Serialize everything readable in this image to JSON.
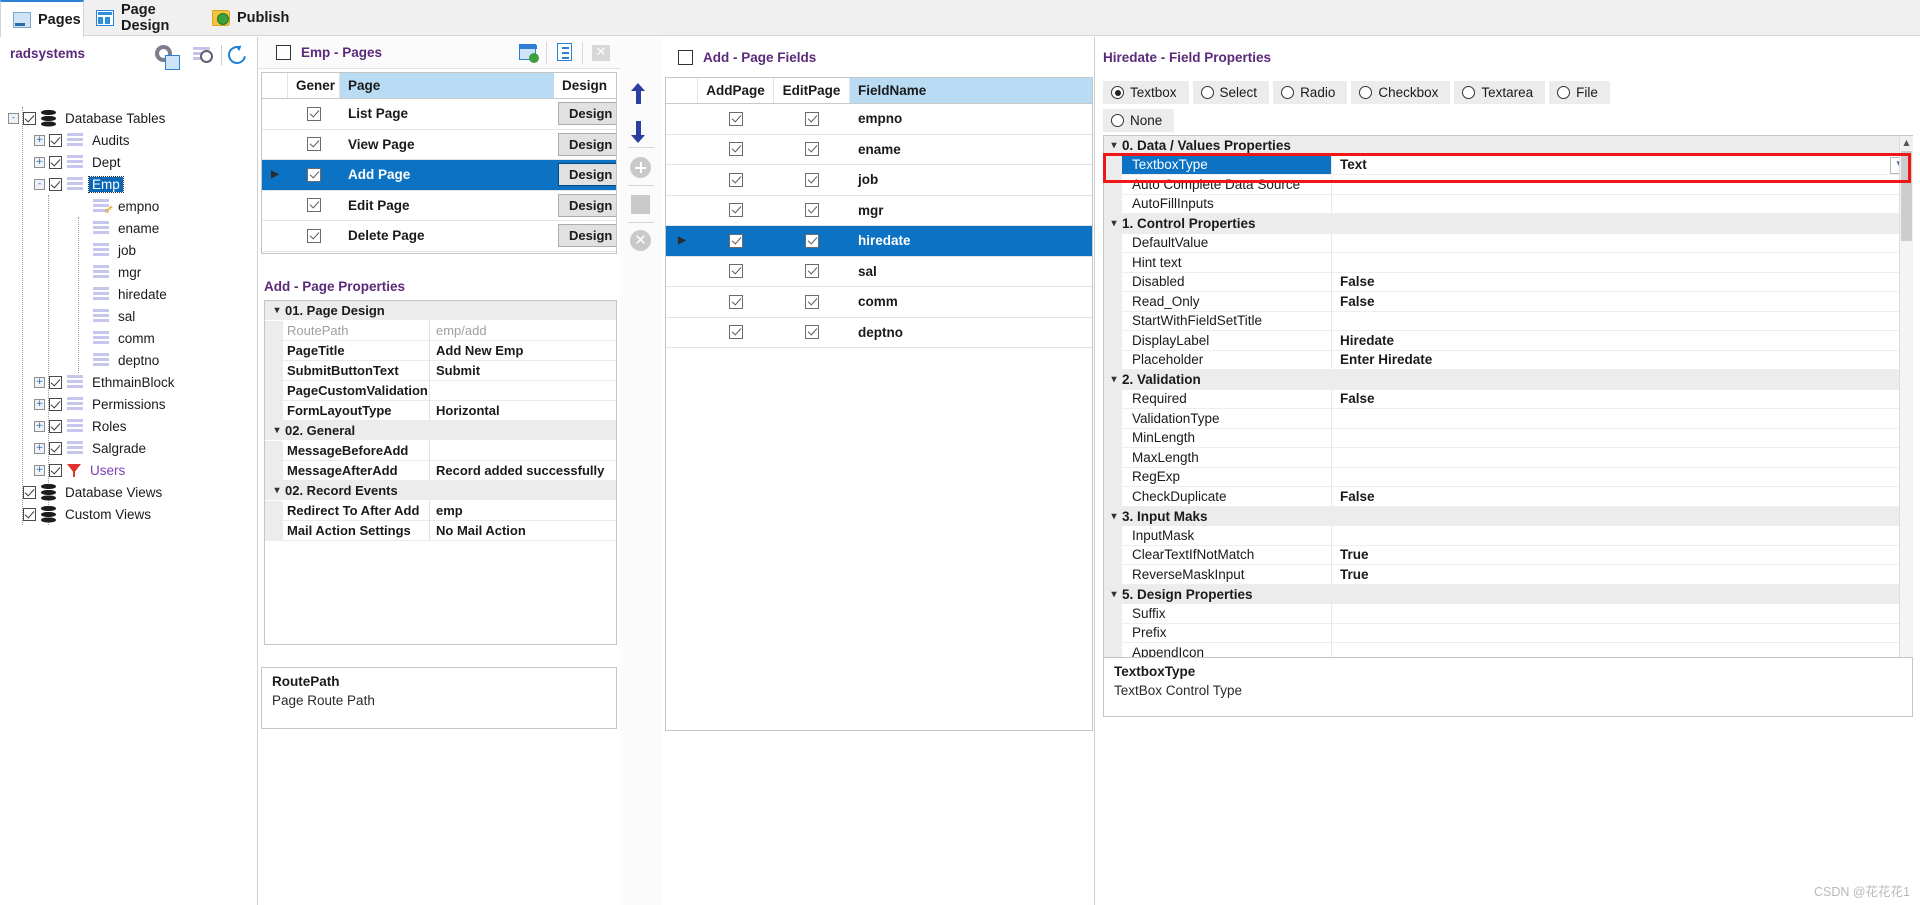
{
  "tabs": [
    {
      "label": "Pages",
      "icon": "pages-icon",
      "active": true
    },
    {
      "label": "Page Design",
      "icon": "page-design-icon",
      "active": false
    },
    {
      "label": "Publish",
      "icon": "publish-icon",
      "active": false
    }
  ],
  "left": {
    "title": "radsystems",
    "tools": [
      {
        "name": "settings-gear-icon",
        "label": ""
      },
      {
        "name": "database-settings-icon",
        "label": ""
      },
      {
        "name": "refresh-icon",
        "label": ""
      }
    ],
    "tree": [
      {
        "label": "Database Tables",
        "depth": 0,
        "expander": "-",
        "checked": true,
        "icon": "database-icon"
      },
      {
        "label": "Audits",
        "depth": 1,
        "expander": "+",
        "checked": true,
        "icon": "table-icon"
      },
      {
        "label": "Dept",
        "depth": 1,
        "expander": "+",
        "checked": true,
        "icon": "table-icon"
      },
      {
        "label": "Emp",
        "depth": 1,
        "expander": "-",
        "checked": true,
        "icon": "table-icon",
        "selected": true
      },
      {
        "label": "empno",
        "depth": 2,
        "expander": "",
        "checked": null,
        "icon": "column-key-icon"
      },
      {
        "label": "ename",
        "depth": 2,
        "expander": "",
        "checked": null,
        "icon": "column-icon"
      },
      {
        "label": "job",
        "depth": 2,
        "expander": "",
        "checked": null,
        "icon": "column-icon"
      },
      {
        "label": "mgr",
        "depth": 2,
        "expander": "",
        "checked": null,
        "icon": "column-icon"
      },
      {
        "label": "hiredate",
        "depth": 2,
        "expander": "",
        "checked": null,
        "icon": "column-icon"
      },
      {
        "label": "sal",
        "depth": 2,
        "expander": "",
        "checked": null,
        "icon": "column-icon"
      },
      {
        "label": "comm",
        "depth": 2,
        "expander": "",
        "checked": null,
        "icon": "column-icon"
      },
      {
        "label": "deptno",
        "depth": 2,
        "expander": "",
        "checked": null,
        "icon": "column-icon"
      },
      {
        "label": "EthmainBlock",
        "depth": 1,
        "expander": "+",
        "checked": true,
        "icon": "table-icon"
      },
      {
        "label": "Permissions",
        "depth": 1,
        "expander": "+",
        "checked": true,
        "icon": "table-icon"
      },
      {
        "label": "Roles",
        "depth": 1,
        "expander": "+",
        "checked": true,
        "icon": "table-icon"
      },
      {
        "label": "Salgrade",
        "depth": 1,
        "expander": "+",
        "checked": true,
        "icon": "table-icon"
      },
      {
        "label": "Users",
        "depth": 1,
        "expander": "+",
        "checked": true,
        "icon": "filter-icon",
        "link": true
      },
      {
        "label": "Database Views",
        "depth": 0,
        "expander": "",
        "checked": true,
        "icon": "database-icon"
      },
      {
        "label": "Custom Views",
        "depth": 0,
        "expander": "",
        "checked": true,
        "icon": "database-icon"
      }
    ]
  },
  "center": {
    "toolbar": [
      {
        "name": "new-page-icon"
      },
      {
        "name": "copy-page-icon"
      },
      {
        "name": "delete-page-icon"
      }
    ],
    "pages_header": "Emp - Pages",
    "pages_columns": [
      "",
      "Gener",
      "Page",
      "Design"
    ],
    "pages_rows": [
      {
        "checked": true,
        "page": "List Page",
        "design": "Design",
        "selected": false
      },
      {
        "checked": true,
        "page": "View Page",
        "design": "Design",
        "selected": false
      },
      {
        "checked": true,
        "page": "Add Page",
        "design": "Design",
        "selected": true
      },
      {
        "checked": true,
        "page": "Edit Page",
        "design": "Design",
        "selected": false
      },
      {
        "checked": true,
        "page": "Delete Page",
        "design": "Design",
        "selected": false
      }
    ],
    "props_header": "Add - Page Properties",
    "props": [
      {
        "type": "cat",
        "name": "01. Page Design"
      },
      {
        "type": "prop",
        "name": "RoutePath",
        "value": "emp/add",
        "dim": true
      },
      {
        "type": "prop",
        "name": "PageTitle",
        "value": "Add New Emp"
      },
      {
        "type": "prop",
        "name": "SubmitButtonText",
        "value": "Submit"
      },
      {
        "type": "prop",
        "name": "PageCustomValidation",
        "value": ""
      },
      {
        "type": "prop",
        "name": "FormLayoutType",
        "value": "Horizontal"
      },
      {
        "type": "cat",
        "name": "02. General"
      },
      {
        "type": "prop",
        "name": "MessageBeforeAdd",
        "value": ""
      },
      {
        "type": "prop",
        "name": "MessageAfterAdd",
        "value": "Record added successfully"
      },
      {
        "type": "cat",
        "name": "02. Record Events"
      },
      {
        "type": "prop",
        "name": "Redirect To After Add",
        "value": "emp"
      },
      {
        "type": "prop",
        "name": "Mail Action Settings",
        "value": "No Mail Action"
      }
    ],
    "desc_title": "RoutePath",
    "desc_text": "Page Route Path"
  },
  "midtools": [
    {
      "name": "move-up-arrow-icon"
    },
    {
      "name": "move-down-arrow-icon"
    },
    {
      "name": "add-field-icon"
    },
    {
      "name": "remove-field-icon"
    },
    {
      "name": "delete-field-icon"
    }
  ],
  "fields": {
    "header": "Add - Page Fields",
    "columns": [
      "",
      "AddPage",
      "EditPage",
      "FieldName"
    ],
    "rows": [
      {
        "add": true,
        "edit": true,
        "field": "empno",
        "selected": false
      },
      {
        "add": true,
        "edit": true,
        "field": "ename",
        "selected": false
      },
      {
        "add": true,
        "edit": true,
        "field": "job",
        "selected": false
      },
      {
        "add": true,
        "edit": true,
        "field": "mgr",
        "selected": false
      },
      {
        "add": true,
        "edit": true,
        "field": "hiredate",
        "selected": true
      },
      {
        "add": true,
        "edit": true,
        "field": "sal",
        "selected": false
      },
      {
        "add": true,
        "edit": true,
        "field": "comm",
        "selected": false
      },
      {
        "add": true,
        "edit": true,
        "field": "deptno",
        "selected": false
      }
    ]
  },
  "right": {
    "header": "Hiredate - Field Properties",
    "control_types": [
      {
        "label": "Textbox",
        "selected": true
      },
      {
        "label": "Select",
        "selected": false
      },
      {
        "label": "Radio",
        "selected": false
      },
      {
        "label": "Checkbox",
        "selected": false
      },
      {
        "label": "Textarea",
        "selected": false
      },
      {
        "label": "File",
        "selected": false
      },
      {
        "label": "None",
        "selected": false
      }
    ],
    "props": [
      {
        "type": "cat",
        "name": "0. Data / Values Properties"
      },
      {
        "type": "prop",
        "name": "TextboxType",
        "value": "Text",
        "selected": true,
        "combo": true
      },
      {
        "type": "prop",
        "name": "Auto Complete Data Source",
        "value": ""
      },
      {
        "type": "prop",
        "name": "AutoFillInputs",
        "value": ""
      },
      {
        "type": "cat",
        "name": "1. Control Properties"
      },
      {
        "type": "prop",
        "name": "DefaultValue",
        "value": ""
      },
      {
        "type": "prop",
        "name": "Hint text",
        "value": ""
      },
      {
        "type": "prop",
        "name": "Disabled",
        "value": "False"
      },
      {
        "type": "prop",
        "name": "Read_Only",
        "value": "False"
      },
      {
        "type": "prop",
        "name": "StartWithFieldSetTitle",
        "value": ""
      },
      {
        "type": "prop",
        "name": "DisplayLabel",
        "value": "Hiredate"
      },
      {
        "type": "prop",
        "name": "Placeholder",
        "value": "Enter Hiredate"
      },
      {
        "type": "cat",
        "name": "2. Validation"
      },
      {
        "type": "prop",
        "name": "Required",
        "value": "False"
      },
      {
        "type": "prop",
        "name": "ValidationType",
        "value": ""
      },
      {
        "type": "prop",
        "name": "MinLength",
        "value": ""
      },
      {
        "type": "prop",
        "name": "MaxLength",
        "value": ""
      },
      {
        "type": "prop",
        "name": "RegExp",
        "value": ""
      },
      {
        "type": "prop",
        "name": "CheckDuplicate",
        "value": "False"
      },
      {
        "type": "cat",
        "name": "3. Input Maks"
      },
      {
        "type": "prop",
        "name": "InputMask",
        "value": ""
      },
      {
        "type": "prop",
        "name": "ClearTextIfNotMatch",
        "value": "True"
      },
      {
        "type": "prop",
        "name": "ReverseMaskInput",
        "value": "True"
      },
      {
        "type": "cat",
        "name": "5. Design Properties"
      },
      {
        "type": "prop",
        "name": "Suffix",
        "value": ""
      },
      {
        "type": "prop",
        "name": "Prefix",
        "value": ""
      },
      {
        "type": "prop",
        "name": "AppendIcon",
        "value": ""
      }
    ],
    "desc_title": "TextboxType",
    "desc_text": "TextBox Control Type"
  },
  "watermark": "CSDN @花花花1",
  "colors": {
    "header_purple": "#5b2a7a",
    "selection_blue": "#0b72c4",
    "highlight_red": "#f01616",
    "column_header_blue": "#b9dcf4"
  }
}
